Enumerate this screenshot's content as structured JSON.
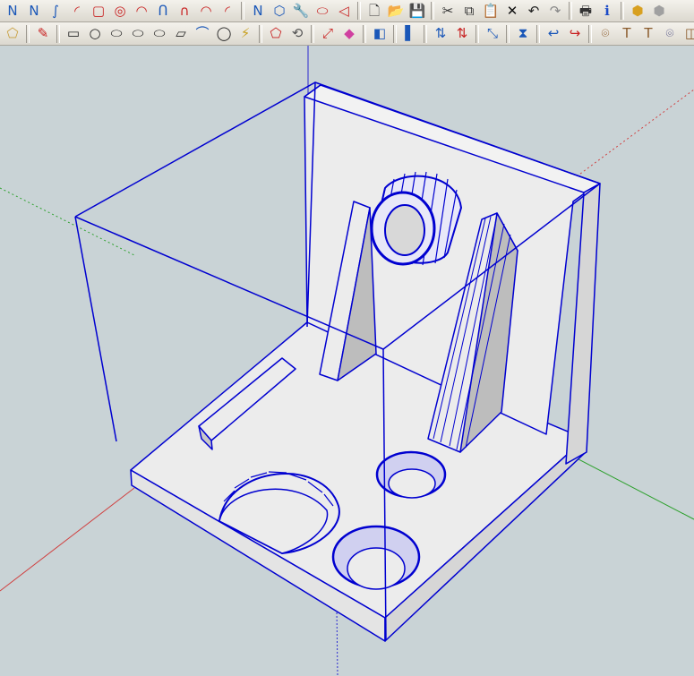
{
  "colors": {
    "viewport_bg": "#c9d3d6",
    "selection_blue": "#0000d0",
    "model_face": "#ececec",
    "model_face_shaded": "#c0c0c0",
    "axis_red": "#d04040",
    "axis_green": "#2ca02c",
    "axis_blue": "#2a2ad0"
  },
  "toolbar_row1": [
    {
      "name": "freehand-icon",
      "glyph": "Ν",
      "color": "#1a57b8"
    },
    {
      "name": "polyline-icon",
      "glyph": "Ν",
      "color": "#1a57b8"
    },
    {
      "name": "spline-icon",
      "glyph": "∫",
      "color": "#1a57b8"
    },
    {
      "name": "arc-icon",
      "glyph": "◜",
      "color": "#c82020"
    },
    {
      "name": "rectangle-icon",
      "glyph": "▢",
      "color": "#c82020"
    },
    {
      "name": "circle-icon",
      "glyph": "◎",
      "color": "#c82020"
    },
    {
      "name": "arc-2pt-icon",
      "glyph": "◠",
      "color": "#c82020"
    },
    {
      "name": "bezier-icon",
      "glyph": "ᑎ",
      "color": "#1a57b8"
    },
    {
      "name": "curve-icon",
      "glyph": "∩",
      "color": "#c82020"
    },
    {
      "name": "arc-3pt-icon",
      "glyph": "◠",
      "color": "#c82020"
    },
    {
      "name": "arc-pie-icon",
      "glyph": "◜",
      "color": "#c82020"
    },
    {
      "name": "sep"
    },
    {
      "name": "line-icon",
      "glyph": "Ν",
      "color": "#1a57b8"
    },
    {
      "name": "polygon-icon",
      "glyph": "⬡",
      "color": "#1a57b8"
    },
    {
      "name": "wrench-icon",
      "glyph": "🔧",
      "color": "#2a8a2a"
    },
    {
      "name": "ellipse-icon",
      "glyph": "⬭",
      "color": "#c82020"
    },
    {
      "name": "sector-icon",
      "glyph": "◁",
      "color": "#c82020"
    },
    {
      "name": "sep"
    },
    {
      "name": "new-document-icon",
      "glyph": "🗋",
      "color": "#333333"
    },
    {
      "name": "open-folder-icon",
      "glyph": "📂",
      "color": "#b8860b"
    },
    {
      "name": "save-icon",
      "glyph": "💾",
      "color": "#1a3a8a"
    },
    {
      "name": "sep"
    },
    {
      "name": "cut-icon",
      "glyph": "✂",
      "color": "#333333"
    },
    {
      "name": "copy-icon",
      "glyph": "⧉",
      "color": "#333333"
    },
    {
      "name": "paste-icon",
      "glyph": "📋",
      "color": "#8a5a2a"
    },
    {
      "name": "erase-icon",
      "glyph": "✕",
      "color": "#111111"
    },
    {
      "name": "undo-icon",
      "glyph": "↶",
      "color": "#222222"
    },
    {
      "name": "redo-icon",
      "glyph": "↷",
      "color": "#888888"
    },
    {
      "name": "sep"
    },
    {
      "name": "print-icon",
      "glyph": "🖶",
      "color": "#333333"
    },
    {
      "name": "info-icon",
      "glyph": "ℹ",
      "color": "#1a4ac8"
    },
    {
      "name": "sep"
    },
    {
      "name": "component-icon",
      "glyph": "⬢",
      "color": "#d8a020"
    },
    {
      "name": "group-icon",
      "glyph": "⬢",
      "color": "#a0a0a0"
    }
  ],
  "toolbar_row2": [
    {
      "name": "select-icon",
      "glyph": "⬠",
      "color": "#c8a040"
    },
    {
      "name": "sep"
    },
    {
      "name": "pencil-icon",
      "glyph": "✎",
      "color": "#c82020"
    },
    {
      "name": "sep"
    },
    {
      "name": "rectangle-small-icon",
      "glyph": "▭",
      "color": "#222222"
    },
    {
      "name": "circle-small-icon",
      "glyph": "○",
      "color": "#222222"
    },
    {
      "name": "shape-ellipse-icon",
      "glyph": "⬭",
      "color": "#222222"
    },
    {
      "name": "shape-rounded-icon",
      "glyph": "⬭",
      "color": "#222222"
    },
    {
      "name": "shape-ellipse-wide-icon",
      "glyph": "⬭",
      "color": "#222222"
    },
    {
      "name": "parallelogram-icon",
      "glyph": "▱",
      "color": "#222222"
    },
    {
      "name": "arch-icon",
      "glyph": "⌒",
      "color": "#1a57b8"
    },
    {
      "name": "sphere-icon",
      "glyph": "◯",
      "color": "#222222"
    },
    {
      "name": "paint-bucket-icon",
      "glyph": "⚡",
      "color": "#c8a020"
    },
    {
      "name": "sep"
    },
    {
      "name": "offset-icon",
      "glyph": "⬠",
      "color": "#c82020"
    },
    {
      "name": "rotate-icon",
      "glyph": "⟲",
      "color": "#555555"
    },
    {
      "name": "sep"
    },
    {
      "name": "move-icon",
      "glyph": "⤢",
      "color": "#c82020"
    },
    {
      "name": "eraser-icon",
      "glyph": "◆",
      "color": "#d040a0"
    },
    {
      "name": "sep"
    },
    {
      "name": "pushpull-icon",
      "glyph": "◧",
      "color": "#1a57b8"
    },
    {
      "name": "sep"
    },
    {
      "name": "follow-me-icon",
      "glyph": "▌",
      "color": "#1a57b8"
    },
    {
      "name": "sep"
    },
    {
      "name": "flip-up-icon",
      "glyph": "⇅",
      "color": "#1a57b8"
    },
    {
      "name": "flip-down-icon",
      "glyph": "⇅",
      "color": "#c82020"
    },
    {
      "name": "sep"
    },
    {
      "name": "scale-icon",
      "glyph": "⤡",
      "color": "#1a57b8"
    },
    {
      "name": "sep"
    },
    {
      "name": "mirror-icon",
      "glyph": "⧗",
      "color": "#1a57b8"
    },
    {
      "name": "sep"
    },
    {
      "name": "bend-icon",
      "glyph": "↩",
      "color": "#1a57b8"
    },
    {
      "name": "twist-icon",
      "glyph": "↪",
      "color": "#c82020"
    },
    {
      "name": "sep"
    },
    {
      "name": "unfold-icon",
      "glyph": "⌾",
      "color": "#8a5a2a"
    },
    {
      "name": "texture-t-icon",
      "glyph": "T",
      "color": "#8a5a2a"
    },
    {
      "name": "texture-t2-icon",
      "glyph": "T",
      "color": "#8a5a2a"
    },
    {
      "name": "unwrap-icon",
      "glyph": "⌾",
      "color": "#5a5a8a"
    },
    {
      "name": "surface-icon",
      "glyph": "◫",
      "color": "#8a5a2a"
    }
  ]
}
